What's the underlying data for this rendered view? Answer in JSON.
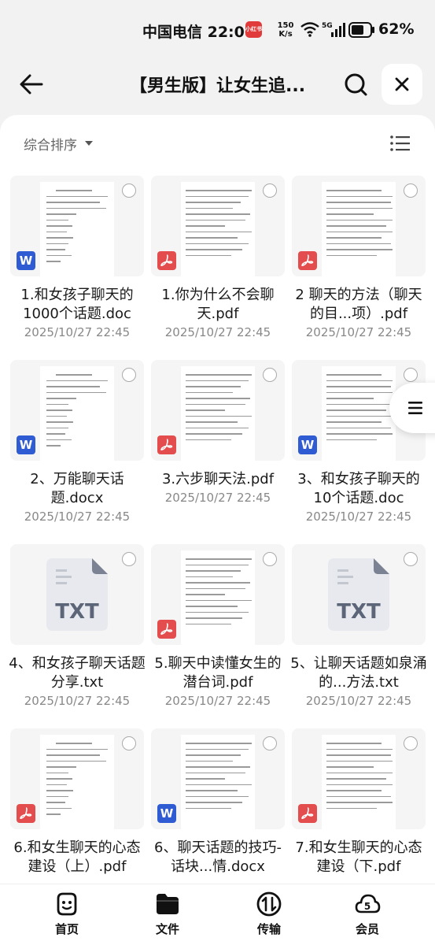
{
  "status": {
    "carrier_time": "中国电信 22:00",
    "app_badge": "小红书",
    "speed_value": "150",
    "speed_unit": "K/s",
    "battery": "62%"
  },
  "header": {
    "title": "【男生版】让女生追..."
  },
  "sort": {
    "label": "综合排序"
  },
  "files": [
    {
      "name": "1.和女孩子聊天的1000个话题.doc",
      "date": "2025/10/27 22:45",
      "type": "word"
    },
    {
      "name": "1.你为什么不会聊天.pdf",
      "date": "2025/10/27 22:45",
      "type": "pdf"
    },
    {
      "name": "2 聊天的方法（聊天的目...项）.pdf",
      "date": "2025/10/27 22:45",
      "type": "pdf"
    },
    {
      "name": "2、万能聊天话题.docx",
      "date": "2025/10/27 22:45",
      "type": "word"
    },
    {
      "name": "3.六步聊天法.pdf",
      "date": "2025/10/27 22:45",
      "type": "pdf"
    },
    {
      "name": "3、和女孩子聊天的10个话题.doc",
      "date": "2025/10/27 22:45",
      "type": "word"
    },
    {
      "name": "4、和女孩子聊天话题分享.txt",
      "date": "2025/10/27 22:45",
      "type": "txt"
    },
    {
      "name": "5.聊天中读懂女生的潜台词.pdf",
      "date": "2025/10/27 22:45",
      "type": "pdf"
    },
    {
      "name": "5、让聊天话题如泉涌的...方法.txt",
      "date": "2025/10/27 22:45",
      "type": "txt"
    },
    {
      "name": "6.和女生聊天的心态建设（上）.pdf",
      "date": "",
      "type": "pdf"
    },
    {
      "name": "6、聊天话题的技巧-话块...情.docx",
      "date": "",
      "type": "word"
    },
    {
      "name": "7.和女生聊天的心态建设（下.pdf",
      "date": "",
      "type": "pdf"
    }
  ],
  "txt_label": "TXT",
  "nav": {
    "home": "首页",
    "files": "文件",
    "transfer": "传输",
    "vip": "会员"
  },
  "colors": {
    "word": "#2f5bd3",
    "pdf": "#e44d4d",
    "background": "#f2f2f2"
  }
}
